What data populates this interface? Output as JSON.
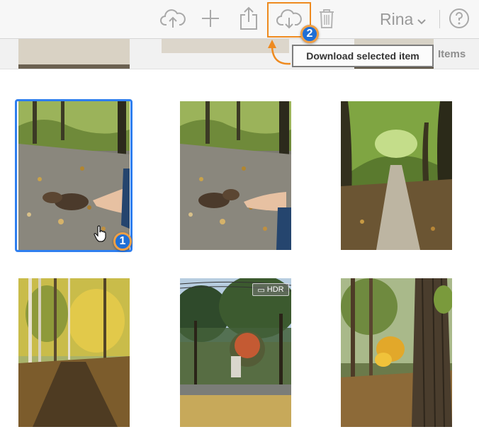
{
  "toolbar": {
    "icons": [
      "upload-cloud-icon",
      "plus-icon",
      "share-icon",
      "download-cloud-icon",
      "trash-icon",
      "help-icon"
    ],
    "user_name": "Rina",
    "accent": "#ee8a1f"
  },
  "subheader": {
    "items_label": "Items"
  },
  "tooltip": {
    "text": "Download selected item"
  },
  "annotations": {
    "step1": "1",
    "step2": "2",
    "badge_color": "#1f6fd6",
    "selection_color": "#2f7ff0"
  },
  "photos": [
    {
      "name": "squirrel-photo-1",
      "selected": true
    },
    {
      "name": "squirrel-photo-2",
      "selected": false
    },
    {
      "name": "forest-path-photo",
      "selected": false
    },
    {
      "name": "autumn-birch-photo",
      "selected": false
    },
    {
      "name": "park-statue-photo",
      "selected": false,
      "badge": "HDR"
    },
    {
      "name": "tree-trunk-photo",
      "selected": false
    }
  ]
}
